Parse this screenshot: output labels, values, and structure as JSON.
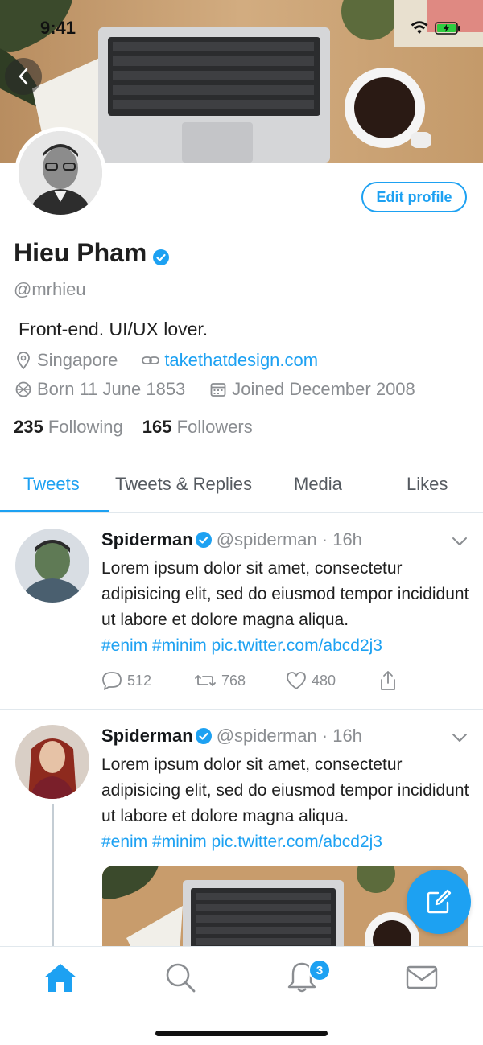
{
  "status_bar": {
    "time": "9:41"
  },
  "profile": {
    "name": "Hieu Pham",
    "handle": "@mrhieu",
    "bio": "Front-end. UI/UX lover.",
    "location": "Singapore",
    "website": "takethatdesign.com",
    "born": "Born 11 June 1853",
    "joined": "Joined December 2008",
    "following_count": "235",
    "following_label": "Following",
    "followers_count": "165",
    "followers_label": "Followers",
    "edit_label": "Edit profile"
  },
  "tabs": [
    {
      "label": "Tweets",
      "active": true
    },
    {
      "label": "Tweets & Replies",
      "active": false
    },
    {
      "label": "Media",
      "active": false
    },
    {
      "label": "Likes",
      "active": false
    }
  ],
  "tweets": [
    {
      "name": "Spiderman",
      "handle": "@spiderman",
      "time": "· 16h",
      "text": "Lorem ipsum dolor sit amet, consectetur adipisicing elit, sed do eiusmod tempor incididunt ut labore et dolore magna aliqua.",
      "tags": "#enim #minim pic.twitter.com/abcd2j3",
      "replies": "512",
      "retweets": "768",
      "likes": "480"
    },
    {
      "name": "Spiderman",
      "handle": "@spiderman",
      "time": "· 16h",
      "text": "Lorem ipsum dolor sit amet, consectetur adipisicing elit, sed do eiusmod tempor incididunt ut labore et dolore magna aliqua.",
      "tags": "#enim #minim pic.twitter.com/abcd2j3"
    }
  ],
  "bottom_nav": {
    "notifications_badge": "3"
  },
  "colors": {
    "accent": "#1da1f2",
    "text": "#14171a",
    "muted": "#8a8d91",
    "border": "#e1e8ed"
  },
  "icons": [
    "back-icon",
    "wifi-icon",
    "battery-icon",
    "verified-icon",
    "location-icon",
    "link-icon",
    "birthday-icon",
    "calendar-icon",
    "chevron-down-icon",
    "reply-icon",
    "retweet-icon",
    "like-icon",
    "share-icon",
    "compose-icon",
    "home-icon",
    "search-icon",
    "bell-icon",
    "mail-icon"
  ]
}
